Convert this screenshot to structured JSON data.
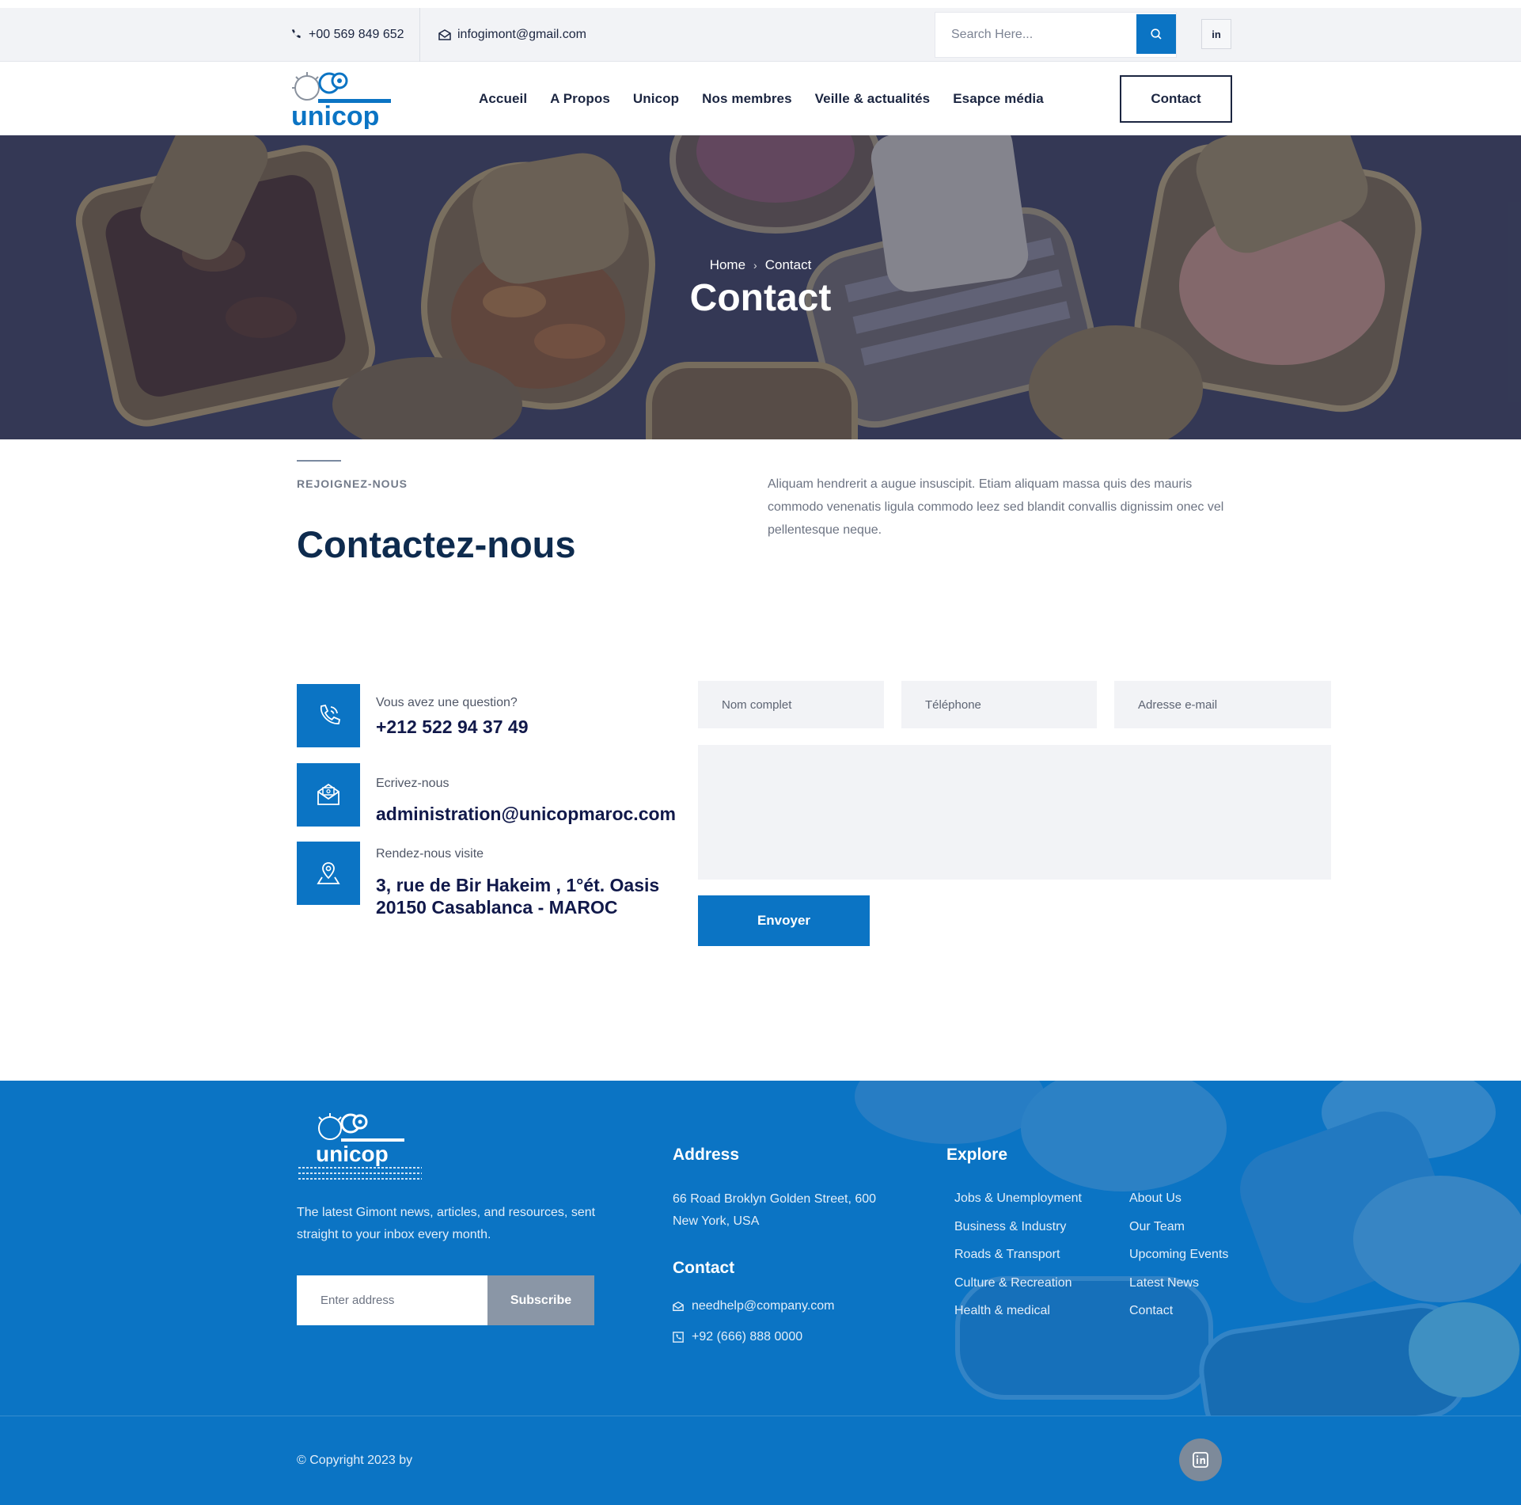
{
  "topbar": {
    "phone": "+00 569 849 652",
    "email": "infogimont@gmail.com",
    "search_placeholder": "Search Here...",
    "linkedin_label": "in"
  },
  "nav": {
    "brand": "unicop",
    "items": [
      "Accueil",
      "A Propos",
      "Unicop",
      "Nos membres",
      "Veille & actualités",
      "Esapce média"
    ],
    "cta": "Contact"
  },
  "hero": {
    "breadcrumb_home": "Home",
    "breadcrumb_current": "Contact",
    "title": "Contact"
  },
  "intro": {
    "eyebrow": "REJOIGNEZ-NOUS",
    "title": "Contactez-nous",
    "text": "Aliquam hendrerit a augue insuscipit. Etiam aliquam massa quis des mauris commodo venenatis ligula commodo leez sed blandit convallis dignissim onec vel pellentesque neque."
  },
  "contact_info": [
    {
      "icon": "phone-call-icon",
      "label": "Vous avez une question?",
      "value": "+212 522 94 37 49"
    },
    {
      "icon": "envelope-icon",
      "label": "Ecrivez-nous",
      "value": "administration@unicopmaroc.com"
    },
    {
      "icon": "map-pin-icon",
      "label": "Rendez-nous visite",
      "value_line1": "3, rue de Bir Hakeim , 1°ét. Oasis",
      "value_line2": "20150 Casablanca - MAROC"
    }
  ],
  "form": {
    "name_placeholder": "Nom complet",
    "phone_placeholder": "Téléphone",
    "email_placeholder": "Adresse e-mail",
    "submit": "Envoyer"
  },
  "footer": {
    "brand": "unicop",
    "about": "The latest Gimont news, articles, and resources, sent straight to your inbox every month.",
    "newsletter_placeholder": "Enter address",
    "subscribe": "Subscribe",
    "address_heading": "Address",
    "address": "66 Road Broklyn Golden Street, 600 New York, USA",
    "contact_heading": "Contact",
    "contact_email": "needhelp@company.com",
    "contact_phone": "+92 (666) 888 0000",
    "explore_heading": "Explore",
    "explore_col1": [
      "Jobs & Unemployment",
      "Business & Industry",
      "Roads & Transport",
      "Culture & Recreation",
      "Health & medical"
    ],
    "explore_col2": [
      "About Us",
      "Our Team",
      "Upcoming Events",
      "Latest News",
      "Contact"
    ],
    "copyright": "© Copyright 2023 by"
  },
  "colors": {
    "primary": "#0b74c4",
    "navy": "#11194a",
    "field_bg": "#f2f3f6"
  }
}
